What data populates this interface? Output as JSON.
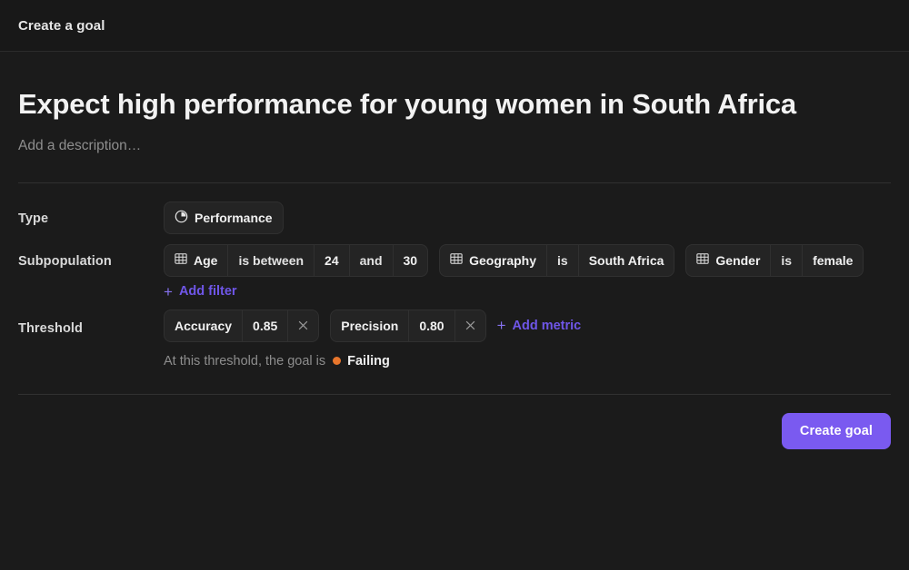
{
  "header": {
    "title": "Create a goal"
  },
  "goal": {
    "title": "Expect high performance for young women in South Africa",
    "description_placeholder": "Add a description…"
  },
  "fields": {
    "type": {
      "label": "Type",
      "icon": "pie-chart-icon",
      "value": "Performance"
    },
    "subpopulation": {
      "label": "Subpopulation",
      "filters": [
        {
          "icon": "table-icon",
          "attribute": "Age",
          "operator": "is between",
          "value": "24",
          "conjunction": "and",
          "value2": "30"
        },
        {
          "icon": "table-icon",
          "attribute": "Geography",
          "operator": "is",
          "value": "South Africa"
        },
        {
          "icon": "table-icon",
          "attribute": "Gender",
          "operator": "is",
          "value": "female"
        }
      ],
      "add_label": "Add filter",
      "add_plus": "+"
    },
    "threshold": {
      "label": "Threshold",
      "metrics": [
        {
          "name": "Accuracy",
          "value": "0.85",
          "remove_icon": "close-icon"
        },
        {
          "name": "Precision",
          "value": "0.80",
          "remove_icon": "close-icon"
        }
      ],
      "add_label": "Add metric",
      "add_plus": "+",
      "status_prefix": "At this threshold, the goal is",
      "status_value": "Failing",
      "status_color": "#e8762c"
    }
  },
  "footer": {
    "primary_label": "Create goal",
    "primary_color": "#7a5af0"
  }
}
